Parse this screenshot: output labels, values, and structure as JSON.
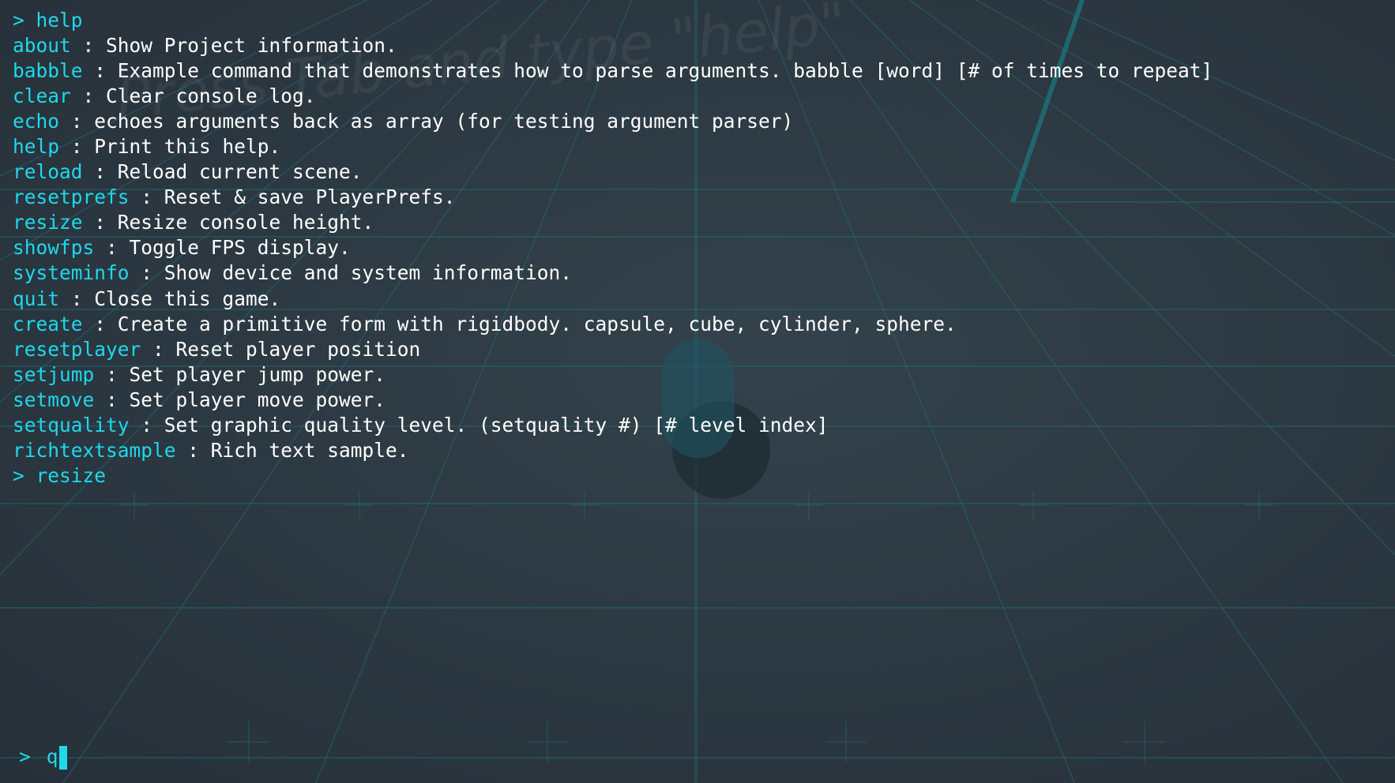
{
  "scene": {
    "watermark_text": "Press Tab and type \"help\"",
    "grid_color": "#1f6f77",
    "player_color": "#1e5560"
  },
  "console": {
    "lines": [
      {
        "kind": "prompt",
        "prompt": ">",
        "text": "help"
      },
      {
        "kind": "entry",
        "command": "about",
        "description": "Show Project information."
      },
      {
        "kind": "entry",
        "command": "babble",
        "description": "Example command that demonstrates how to parse arguments. babble [word] [# of times to repeat]"
      },
      {
        "kind": "entry",
        "command": "clear",
        "description": "Clear console log."
      },
      {
        "kind": "entry",
        "command": "echo",
        "description": "echoes arguments back as array (for testing argument parser)"
      },
      {
        "kind": "entry",
        "command": "help",
        "description": "Print this help."
      },
      {
        "kind": "entry",
        "command": "reload",
        "description": "Reload current scene."
      },
      {
        "kind": "entry",
        "command": "resetprefs",
        "description": "Reset & save PlayerPrefs."
      },
      {
        "kind": "entry",
        "command": "resize",
        "description": "Resize console height."
      },
      {
        "kind": "entry",
        "command": "showfps",
        "description": "Toggle FPS display."
      },
      {
        "kind": "entry",
        "command": "systeminfo",
        "description": "Show device and system information."
      },
      {
        "kind": "entry",
        "command": "quit",
        "description": "Close this game."
      },
      {
        "kind": "entry",
        "command": "create",
        "description": "Create a primitive form with rigidbody. capsule, cube, cylinder, sphere."
      },
      {
        "kind": "entry",
        "command": "resetplayer",
        "description": "Reset player position"
      },
      {
        "kind": "entry",
        "command": "setjump",
        "description": "Set player jump power."
      },
      {
        "kind": "entry",
        "command": "setmove",
        "description": "Set player move power."
      },
      {
        "kind": "entry",
        "command": "setquality",
        "description": "Set graphic quality level. (setquality #) [# level index]"
      },
      {
        "kind": "entry",
        "command": "richtextsample",
        "description": "Rich text sample."
      },
      {
        "kind": "prompt",
        "prompt": ">",
        "text": "resize"
      }
    ],
    "separator": " : "
  },
  "input": {
    "prompt": ">",
    "value": "q"
  },
  "colors": {
    "accent": "#1ed8ec",
    "text": "#ffffff",
    "background": "#2b363e"
  }
}
